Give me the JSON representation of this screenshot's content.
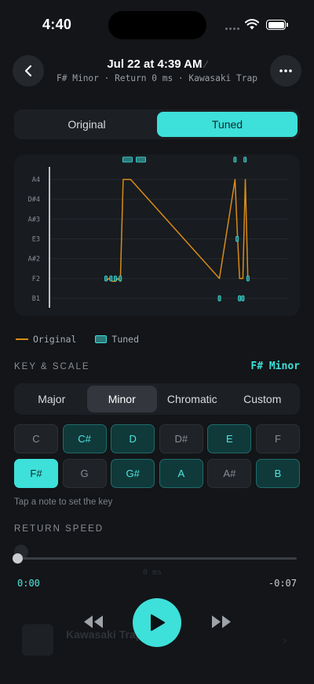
{
  "status_bar": {
    "time": "4:40"
  },
  "header": {
    "title": "Jul 22 at 4:39 AM",
    "subtitle": "F# Minor · Return 0 ms · Kawasaki Trap"
  },
  "view_toggle": {
    "options": [
      "Original",
      "Tuned"
    ],
    "selected": "Tuned"
  },
  "chart_data": {
    "type": "line",
    "y_categories": [
      "B1",
      "F2",
      "A#2",
      "E3",
      "A#3",
      "D#4",
      "A4"
    ],
    "x_range": [
      0,
      1
    ],
    "series": [
      {
        "name": "Original",
        "color": "#d88b1a",
        "points": [
          [
            0.236,
            0.86
          ],
          [
            0.248,
            1.0
          ],
          [
            0.262,
            0.86
          ],
          [
            0.276,
            0.86
          ],
          [
            0.286,
            1.0
          ],
          [
            0.296,
            0.86
          ],
          [
            0.308,
            6.0
          ],
          [
            0.339,
            6.0
          ],
          [
            0.71,
            1.0
          ],
          [
            0.775,
            6.0
          ],
          [
            0.784,
            3.5
          ],
          [
            0.794,
            1.0
          ],
          [
            0.808,
            1.0
          ],
          [
            0.818,
            6.0
          ],
          [
            0.829,
            0.9
          ]
        ]
      },
      {
        "name": "Tuned",
        "color": "#3ee0da",
        "segments": [
          {
            "x": [
              0.231,
              0.241
            ],
            "y": 1
          },
          {
            "x": [
              0.252,
              0.262
            ],
            "y": 1
          },
          {
            "x": [
              0.27,
              0.28
            ],
            "y": 1
          },
          {
            "x": [
              0.291,
              0.301
            ],
            "y": 1
          },
          {
            "x": [
              0.306,
              0.346
            ],
            "y": 7
          },
          {
            "x": [
              0.362,
              0.402
            ],
            "y": 7
          },
          {
            "x": [
              0.705,
              0.715
            ],
            "y": 0
          },
          {
            "x": [
              0.77,
              0.78
            ],
            "y": 7
          },
          {
            "x": [
              0.779,
              0.789
            ],
            "y": 3
          },
          {
            "x": [
              0.789,
              0.799
            ],
            "y": 0
          },
          {
            "x": [
              0.803,
              0.813
            ],
            "y": 0
          },
          {
            "x": [
              0.812,
              0.822
            ],
            "y": 7
          },
          {
            "x": [
              0.824,
              0.834
            ],
            "y": 1
          }
        ]
      }
    ],
    "grid": true
  },
  "legend": {
    "original": "Original",
    "tuned": "Tuned"
  },
  "key_scale": {
    "label": "KEY & SCALE",
    "value": "F# Minor",
    "scales": [
      "Major",
      "Minor",
      "Chromatic",
      "Custom"
    ],
    "selected_scale": "Minor",
    "notes": [
      {
        "name": "C",
        "state": "off"
      },
      {
        "name": "C#",
        "state": "in"
      },
      {
        "name": "D",
        "state": "in"
      },
      {
        "name": "D#",
        "state": "off"
      },
      {
        "name": "E",
        "state": "in"
      },
      {
        "name": "F",
        "state": "off"
      },
      {
        "name": "F#",
        "state": "root"
      },
      {
        "name": "G",
        "state": "off"
      },
      {
        "name": "G#",
        "state": "in"
      },
      {
        "name": "A",
        "state": "in"
      },
      {
        "name": "A#",
        "state": "off"
      },
      {
        "name": "B",
        "state": "in"
      }
    ],
    "hint": "Tap a note to set the key"
  },
  "return_speed": {
    "label": "RETURN SPEED",
    "value_fraction": 0.0,
    "ghost_value": "0 ms"
  },
  "player": {
    "elapsed": "0:00",
    "remaining": "-0:07",
    "track_title": "Kawasaki Trap",
    "progress": 0.0
  },
  "colors": {
    "accent": "#3ee0da",
    "original_line": "#d88b1a",
    "background": "#131518"
  },
  "icons": [
    "back-chevron-icon",
    "more-icon",
    "edit-pencil-icon",
    "wifi-icon",
    "battery-icon",
    "rewind-icon",
    "play-icon",
    "fast-forward-icon"
  ]
}
